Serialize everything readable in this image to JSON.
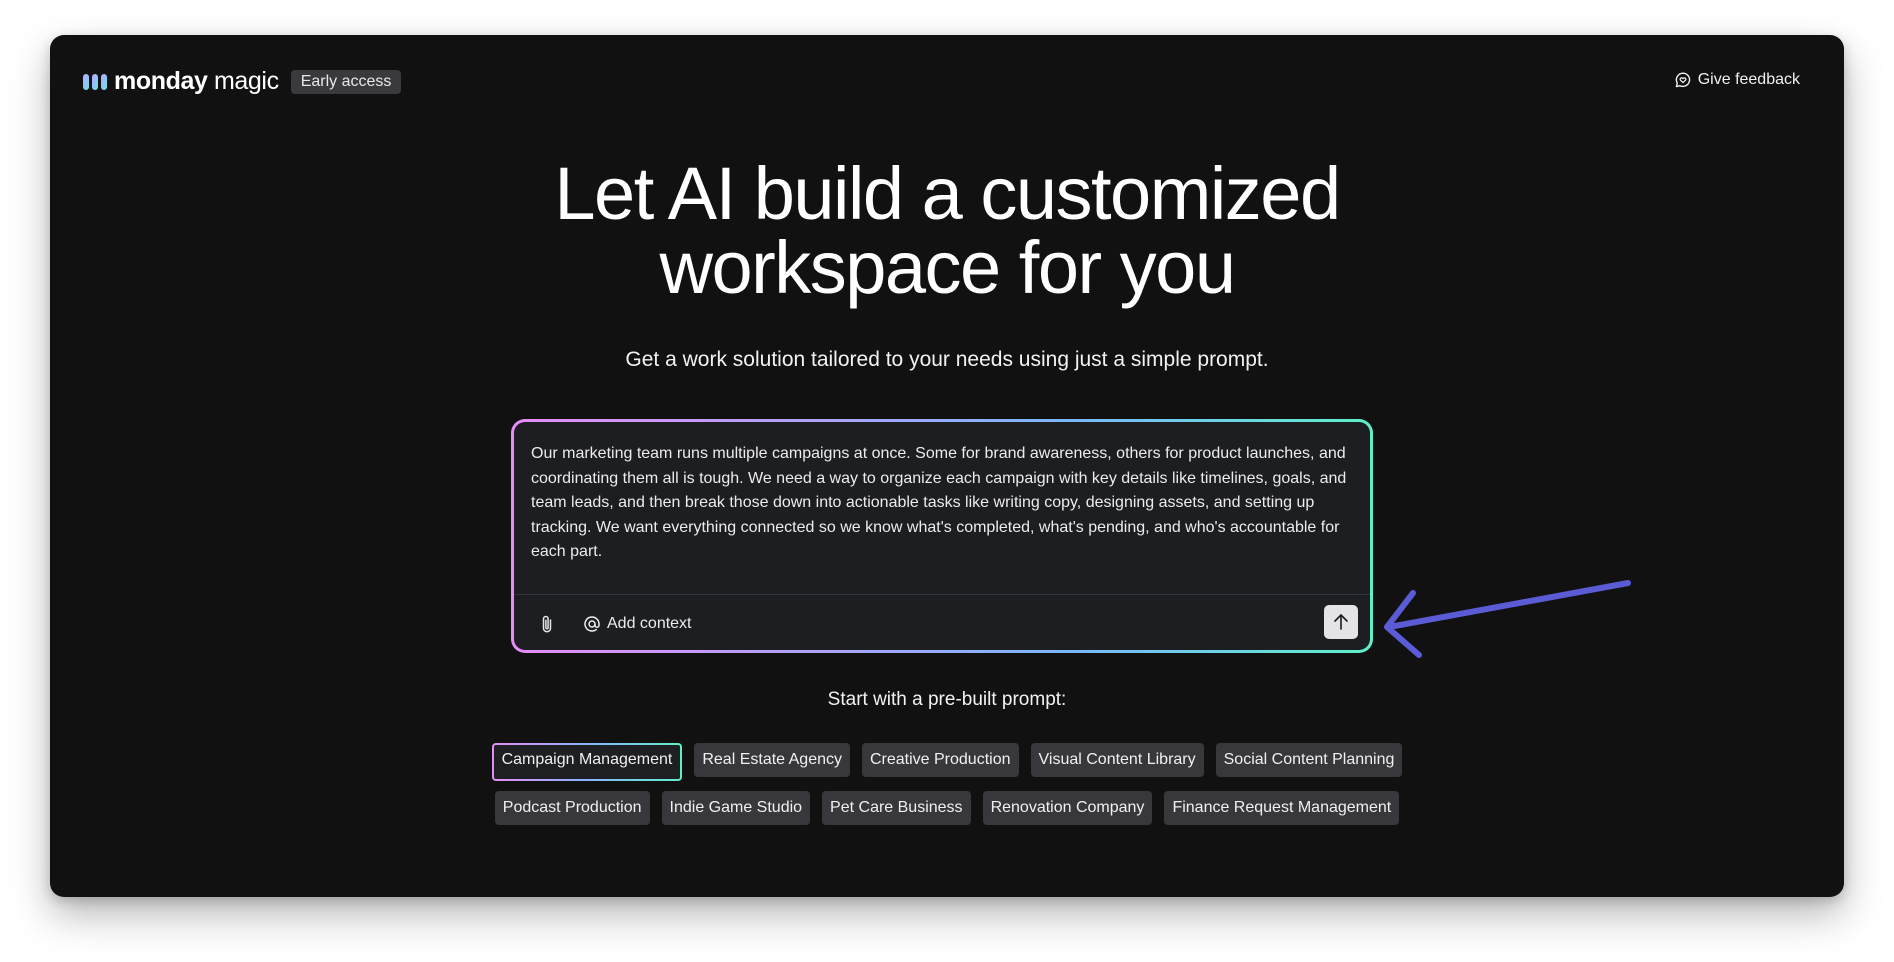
{
  "brand": {
    "name_bold": "monday",
    "name_light": "magic",
    "badge": "Early access"
  },
  "header": {
    "feedback_label": "Give feedback"
  },
  "hero": {
    "title_line1": "Let AI build a customized",
    "title_line2": "workspace for you",
    "subtitle": "Get a work solution tailored to your needs using just a simple prompt."
  },
  "prompt": {
    "value": "Our marketing team runs multiple campaigns at once. Some for brand awareness, others for product launches, and coordinating them all is tough. We need a way to organize each campaign with key details like timelines, goals, and team leads, and then break those down into actionable tasks like writing copy, designing assets, and setting up tracking. We want everything connected so we know what's completed, what's pending, and who's accountable for each part.",
    "add_context_label": "Add context"
  },
  "prebuilt": {
    "heading": "Start with a pre-built prompt:",
    "row1": [
      "Campaign Management",
      "Real Estate Agency",
      "Creative Production",
      "Visual Content Library",
      "Social Content Planning"
    ],
    "row2": [
      "Podcast Production",
      "Indie Game Studio",
      "Pet Care Business",
      "Renovation Company",
      "Finance Request Management"
    ],
    "selected": "Campaign Management"
  },
  "colors": {
    "background": "#111112",
    "accent_gradient": [
      "#e58df5",
      "#7ab7ff",
      "#5ef0c8"
    ],
    "annotation_arrow": "#5b5bd6"
  },
  "icons": {
    "logo": "monday-logo-icon",
    "feedback": "chat-heart-icon",
    "attach": "paperclip-icon",
    "context": "at-sign-icon",
    "send": "arrow-up-icon"
  }
}
